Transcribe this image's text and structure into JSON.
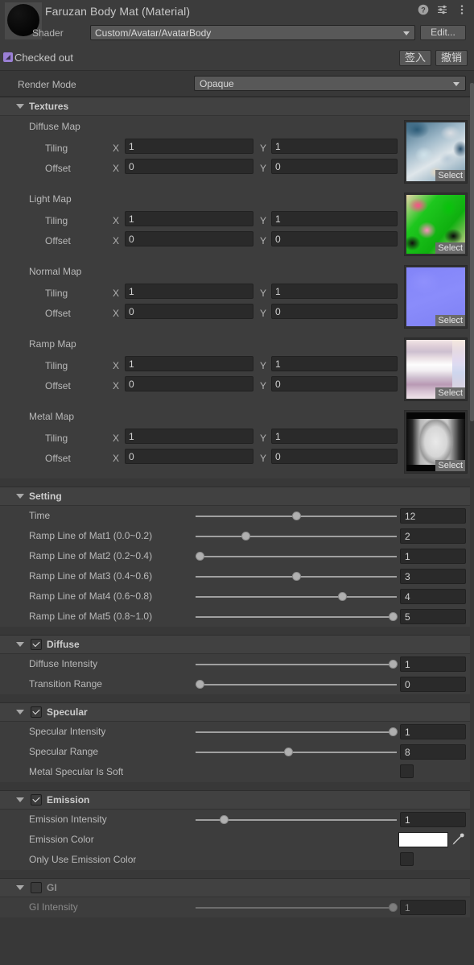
{
  "header": {
    "title": "Faruzan Body Mat (Material)",
    "icons": [
      {
        "name": "help-icon",
        "label": "?"
      },
      {
        "name": "preset-icon",
        "label": "presets"
      },
      {
        "name": "more-menu-icon",
        "label": "⋮"
      }
    ],
    "shader_label": "Shader",
    "shader_value": "Custom/Avatar/AvatarBody",
    "edit_button": "Edit..."
  },
  "vcs": {
    "status": "Checked out",
    "checkin_button": "签入",
    "revert_button": "撤销"
  },
  "render_mode": {
    "label": "Render Mode",
    "value": "Opaque"
  },
  "textures": {
    "group_title": "Textures",
    "tiling_label": "Tiling",
    "offset_label": "Offset",
    "axis_x": "X",
    "axis_y": "Y",
    "select_label": "Select",
    "maps": [
      {
        "name": "Diffuse Map",
        "tiling_x": "1",
        "tiling_y": "1",
        "offset_x": "0",
        "offset_y": "0",
        "art": "art-diffuse"
      },
      {
        "name": "Light Map",
        "tiling_x": "1",
        "tiling_y": "1",
        "offset_x": "0",
        "offset_y": "0",
        "art": "art-light"
      },
      {
        "name": "Normal Map",
        "tiling_x": "1",
        "tiling_y": "1",
        "offset_x": "0",
        "offset_y": "0",
        "art": "art-normal"
      },
      {
        "name": "Ramp Map",
        "tiling_x": "1",
        "tiling_y": "1",
        "offset_x": "0",
        "offset_y": "0",
        "art": "art-ramp"
      },
      {
        "name": "Metal Map",
        "tiling_x": "1",
        "tiling_y": "1",
        "offset_x": "0",
        "offset_y": "0",
        "art": "art-metal"
      }
    ]
  },
  "setting": {
    "group_title": "Setting",
    "rows": [
      {
        "label": "Time",
        "value": "12",
        "knob_pct": 50
      },
      {
        "label": "Ramp Line of Mat1 (0.0~0.2)",
        "value": "2",
        "knob_pct": 25
      },
      {
        "label": "Ramp Line of Mat2 (0.2~0.4)",
        "value": "1",
        "knob_pct": 2
      },
      {
        "label": "Ramp Line of Mat3 (0.4~0.6)",
        "value": "3",
        "knob_pct": 50
      },
      {
        "label": "Ramp Line of Mat4 (0.6~0.8)",
        "value": "4",
        "knob_pct": 73
      },
      {
        "label": "Ramp Line of Mat5 (0.8~1.0)",
        "value": "5",
        "knob_pct": 98
      }
    ]
  },
  "diffuse": {
    "group_title": "Diffuse",
    "checked": true,
    "rows": [
      {
        "label": "Diffuse Intensity",
        "value": "1",
        "knob_pct": 98,
        "type": "slider"
      },
      {
        "label": "Transition Range",
        "value": "0",
        "knob_pct": 2,
        "type": "slider"
      }
    ]
  },
  "specular": {
    "group_title": "Specular",
    "checked": true,
    "rows": [
      {
        "label": "Specular Intensity",
        "value": "1",
        "knob_pct": 98,
        "type": "slider"
      },
      {
        "label": "Specular Range",
        "value": "8",
        "knob_pct": 46,
        "type": "slider"
      },
      {
        "label": "Metal Specular Is Soft",
        "value": "",
        "checked": false,
        "type": "toggle"
      }
    ]
  },
  "emission": {
    "group_title": "Emission",
    "checked": true,
    "rows": [
      {
        "label": "Emission Intensity",
        "value": "1",
        "knob_pct": 14,
        "type": "slider"
      },
      {
        "label": "Emission Color",
        "color": "#ffffff",
        "type": "color"
      },
      {
        "label": "Only Use Emission Color",
        "checked": false,
        "type": "toggle"
      }
    ]
  },
  "gi": {
    "group_title": "GI",
    "checked": false,
    "rows": [
      {
        "label": "GI Intensity",
        "value": "1",
        "knob_pct": 98,
        "type": "slider",
        "disabled": true
      }
    ]
  },
  "colors": {
    "panel_bg": "#383838",
    "header_bg": "#3c3c3c",
    "group_header_bg": "#414141",
    "field_bg": "#2a2a2a",
    "dropdown_bg": "#585858",
    "accent_vcs": "#9a7fd4"
  }
}
